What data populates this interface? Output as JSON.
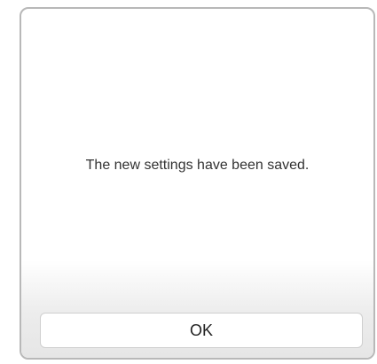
{
  "dialog": {
    "message": "The new settings have been saved.",
    "ok_label": "OK"
  }
}
